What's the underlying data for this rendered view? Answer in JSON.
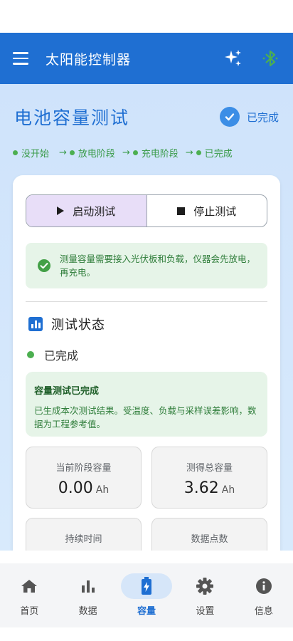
{
  "appbar": {
    "title": "太阳能控制器"
  },
  "page": {
    "title": "电池容量测试",
    "status_badge": "已完成"
  },
  "steps": [
    {
      "label": "没开始"
    },
    {
      "label": "放电阶段"
    },
    {
      "label": "充电阶段"
    },
    {
      "label": "已完成"
    }
  ],
  "step_arrow": "→",
  "controls": {
    "start_label": "启动测试",
    "stop_label": "停止测试"
  },
  "notice": {
    "text": "测量容量需要接入光伏板和负载，仪器会先放电，再充电。"
  },
  "section": {
    "title": "测试状态"
  },
  "status": {
    "text": "已完成"
  },
  "result": {
    "title": "容量测试已完成",
    "text": "已生成本次测试结果。受温度、负载与采样误差影响，数据为工程参考值。"
  },
  "metrics": [
    {
      "label": "当前阶段容量",
      "value": "0.00",
      "unit": "Ah"
    },
    {
      "label": "测得总容量",
      "value": "3.62",
      "unit": "Ah"
    },
    {
      "label": "持续时间",
      "value": "",
      "unit": ""
    },
    {
      "label": "数据点数",
      "value": "",
      "unit": ""
    }
  ],
  "nav": [
    {
      "label": "首页",
      "icon": "home-icon"
    },
    {
      "label": "数据",
      "icon": "bar-chart-icon"
    },
    {
      "label": "容量",
      "icon": "battery-charging-icon"
    },
    {
      "label": "设置",
      "icon": "gear-icon"
    },
    {
      "label": "信息",
      "icon": "info-icon"
    }
  ],
  "colors": {
    "primary": "#1f6fd2",
    "success": "#4caf50",
    "success_bg": "#e6f4e8",
    "selected_segment": "#e8def8"
  }
}
